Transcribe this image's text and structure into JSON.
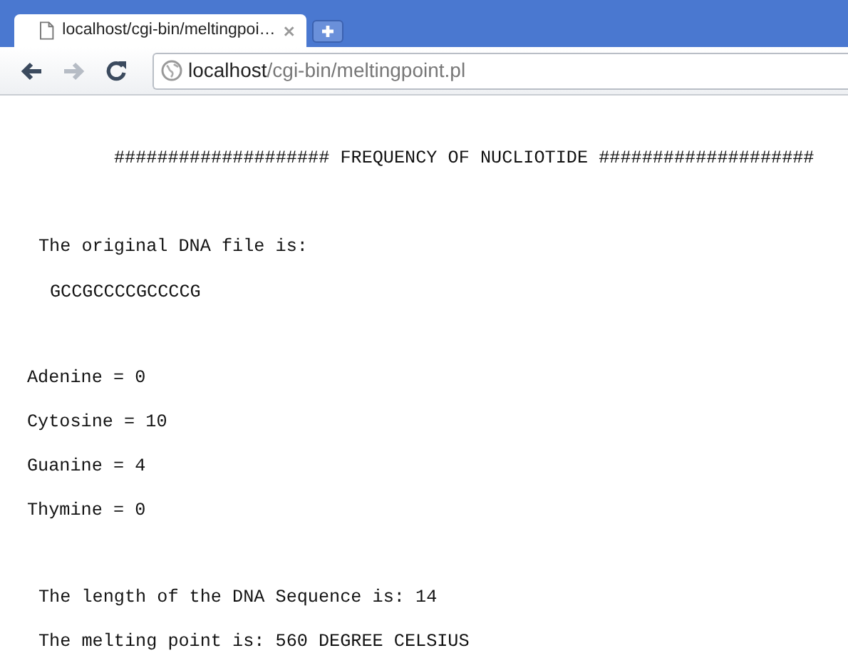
{
  "browser": {
    "tab": {
      "title": "localhost/cgi-bin/meltingpoi…",
      "selected": true
    },
    "address": {
      "host": "localhost",
      "path": "/cgi-bin/meltingpoint.pl"
    }
  },
  "page": {
    "heading": "#################### FREQUENCY OF NUCLIOTIDE ####################",
    "intro": "The original DNA file is:",
    "sequence": "GCCGCCCCGCCCCG",
    "counts": [
      "Adenine = 0",
      "Cytosine = 10",
      "Guanine = 4",
      "Thymine = 0"
    ],
    "length": "The length of the DNA Sequence is: 14",
    "melting": "The melting point is: 560 DEGREE CELSIUS"
  }
}
